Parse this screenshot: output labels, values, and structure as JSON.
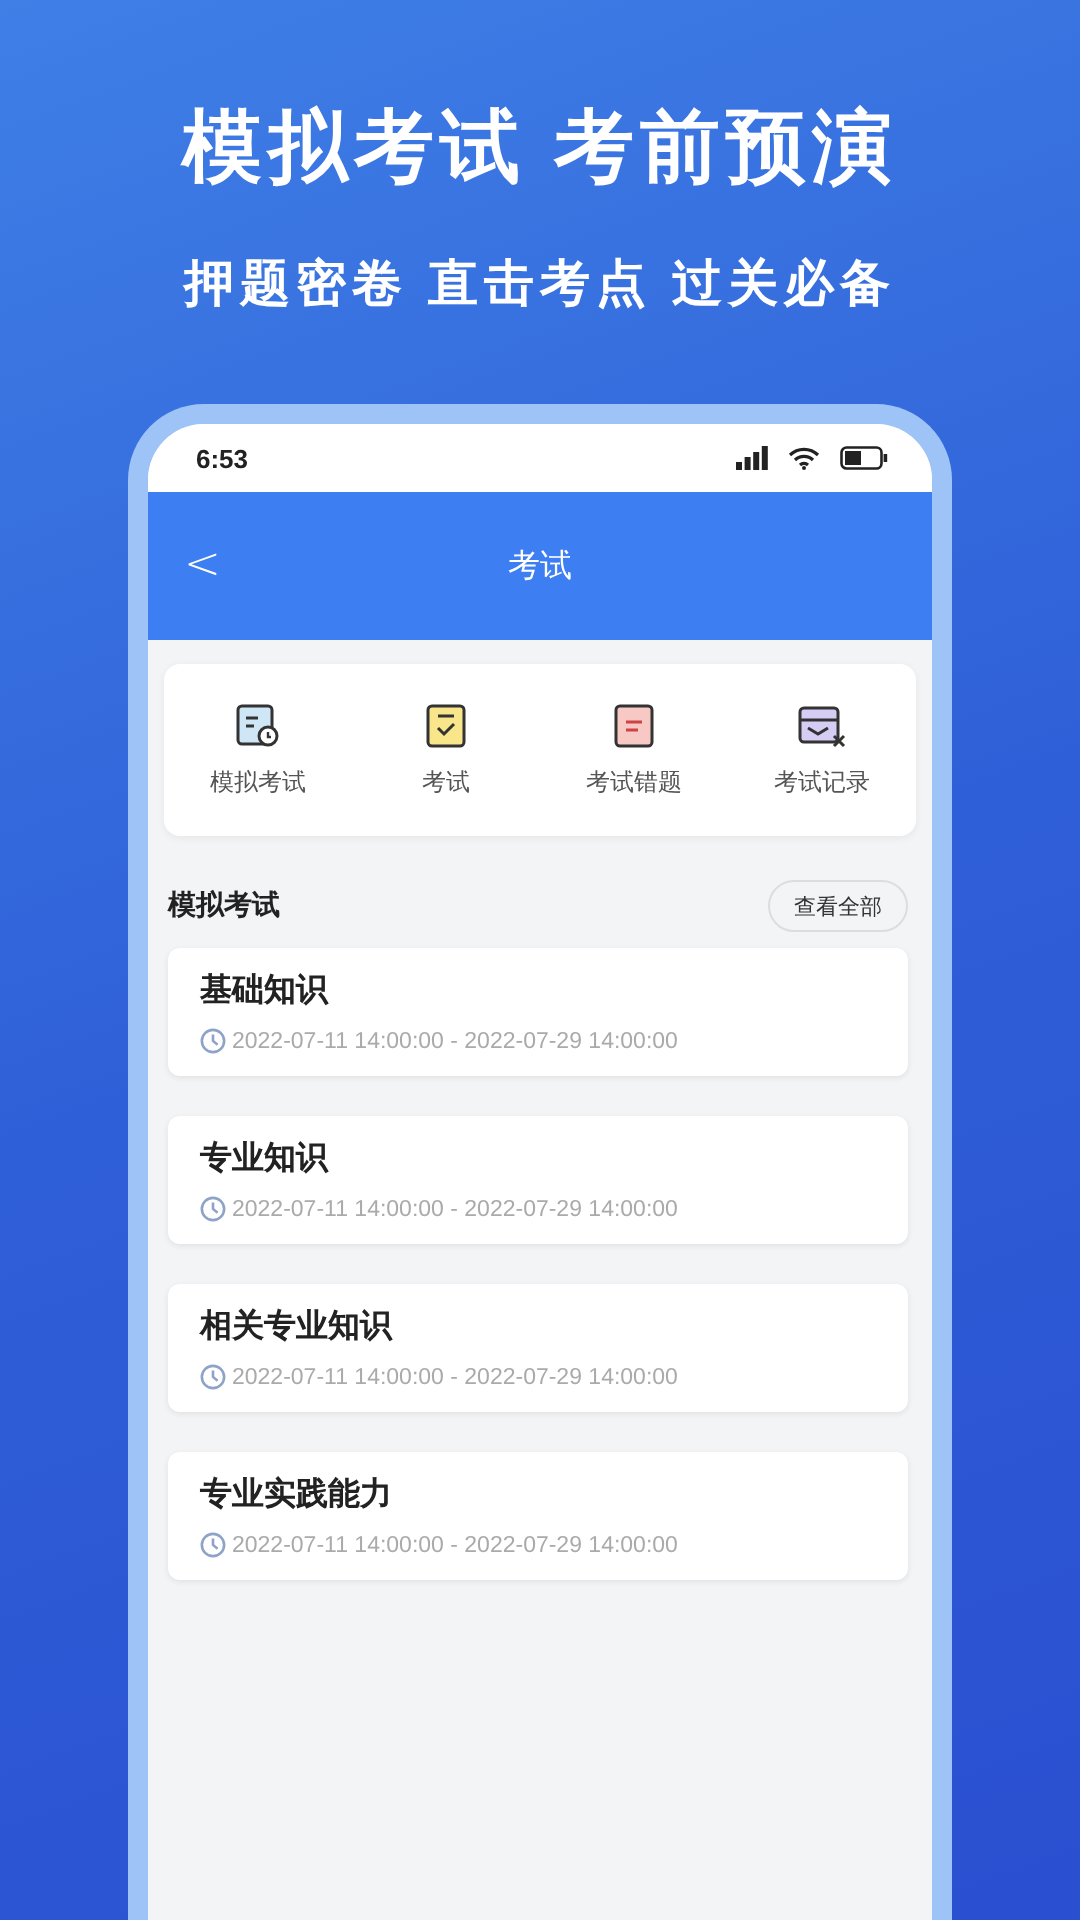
{
  "promo": {
    "headline": "模拟考试 考前预演",
    "subline": "押题密卷 直击考点 过关必备"
  },
  "status_bar": {
    "time": "6:53"
  },
  "nav": {
    "back": "<",
    "title": "考试"
  },
  "shortcuts": [
    {
      "kind": "mock",
      "label": "模拟考试"
    },
    {
      "kind": "exam",
      "label": "考试"
    },
    {
      "kind": "mistakes",
      "label": "考试错题"
    },
    {
      "kind": "records",
      "label": "考试记录"
    }
  ],
  "section": {
    "title": "模拟考试",
    "action": "查看全部"
  },
  "exams": [
    {
      "name": "基础知识",
      "period": "2022-07-11 14:00:00 - 2022-07-29 14:00:00"
    },
    {
      "name": "专业知识",
      "period": "2022-07-11 14:00:00 - 2022-07-29 14:00:00"
    },
    {
      "name": "相关专业知识",
      "period": "2022-07-11 14:00:00 - 2022-07-29 14:00:00"
    },
    {
      "name": "专业实践能力",
      "period": "2022-07-11 14:00:00 - 2022-07-29 14:00:00"
    }
  ]
}
